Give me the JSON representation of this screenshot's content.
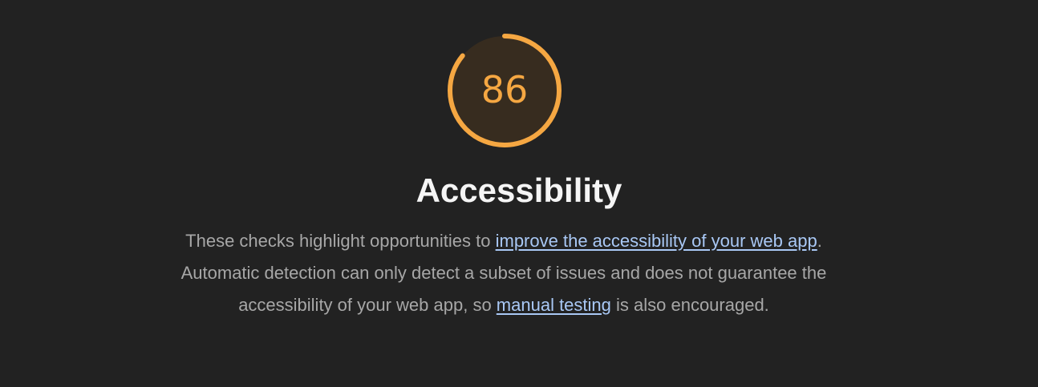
{
  "category": {
    "score": 86,
    "score_label": "86",
    "score_fraction": 0.86,
    "title": "Accessibility",
    "gauge_color": "#f5a742",
    "gauge_fill_color": "#372c1f"
  },
  "description": {
    "part1": "These checks highlight opportunities to ",
    "link1": "improve the accessibility of your web app",
    "part2": ". Automatic detection can only detect a subset of issues and does not guarantee the accessibility of your web app, so ",
    "link2": "manual testing",
    "part3": " is also encouraged."
  },
  "colors": {
    "background": "#222222",
    "link": "#a9c8f5",
    "text": "#a7a7a7",
    "title": "#f5f5f5"
  }
}
